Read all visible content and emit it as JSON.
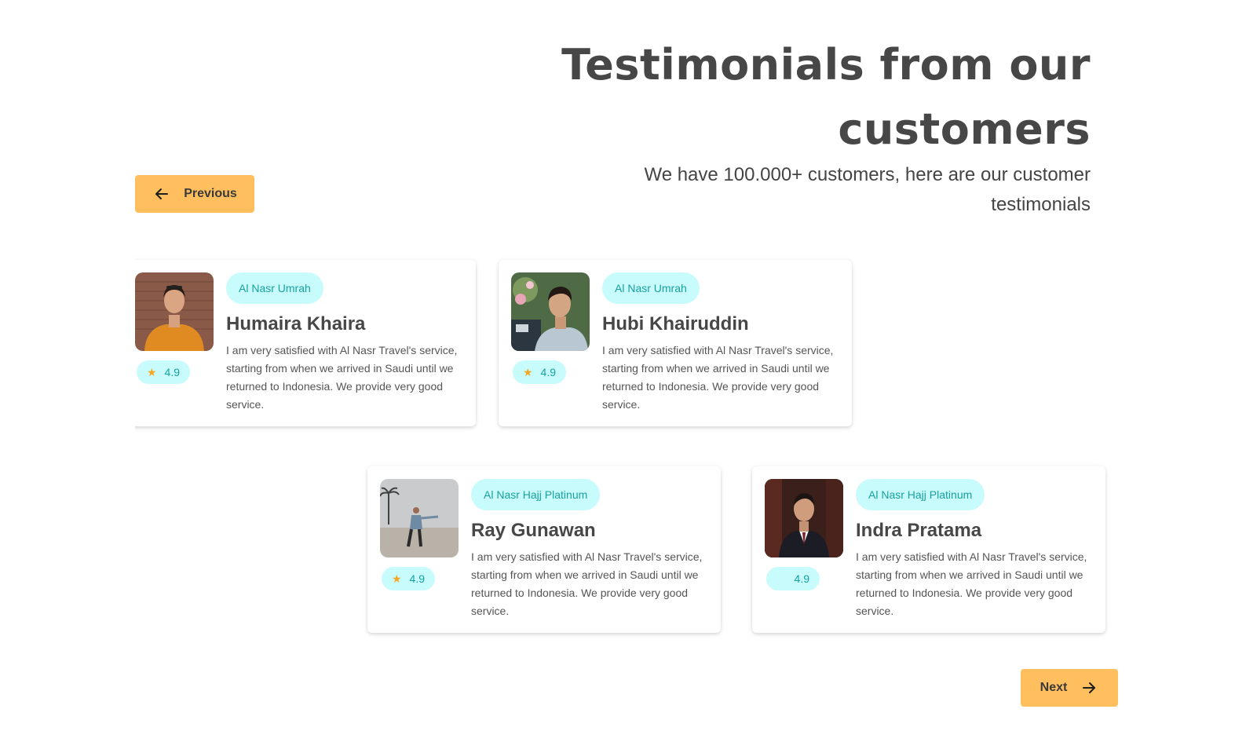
{
  "header": {
    "title": "Testimonials from our customers",
    "subtitle": "We have 100.000+ customers, here are our customer testimonials"
  },
  "nav": {
    "previous_label": "Previous",
    "next_label": "Next"
  },
  "testimonials": [
    {
      "package": "Al Nasr Umrah",
      "name": "Humaira Khaira",
      "rating": "4.9",
      "quote": "I am very satisfied with Al Nasr Travel's service, starting from when we arrived in Saudi until we returned to Indonesia. We provide very good service."
    },
    {
      "package": "Al Nasr Umrah",
      "name": "Hubi Khairuddin",
      "rating": "4.9",
      "quote": "I am very satisfied with Al Nasr Travel's service, starting from when we arrived in Saudi until we returned to Indonesia. We provide very good service."
    },
    {
      "package": "Al Nasr Hajj Platinum",
      "name": "Ray Gunawan",
      "rating": "4.9",
      "quote": "I am very satisfied with Al Nasr Travel's service, starting from when we arrived in Saudi until we returned to Indonesia. We provide very good service."
    },
    {
      "package": "Al Nasr Hajj Platinum",
      "name": "Indra Pratama",
      "rating": "4.9",
      "quote": "I am very satisfied with Al Nasr Travel's service, starting from when we arrived in Saudi until we returned to Indonesia. We provide very good service."
    }
  ],
  "colors": {
    "accent": "#ffbf5e",
    "tag_bg": "#c8fbfb",
    "tag_text": "#18a19f",
    "star": "#f5a623",
    "heading": "#474747"
  },
  "icons": {
    "previous": "arrow-left-icon",
    "next": "arrow-right-icon",
    "rating": "star-icon"
  }
}
